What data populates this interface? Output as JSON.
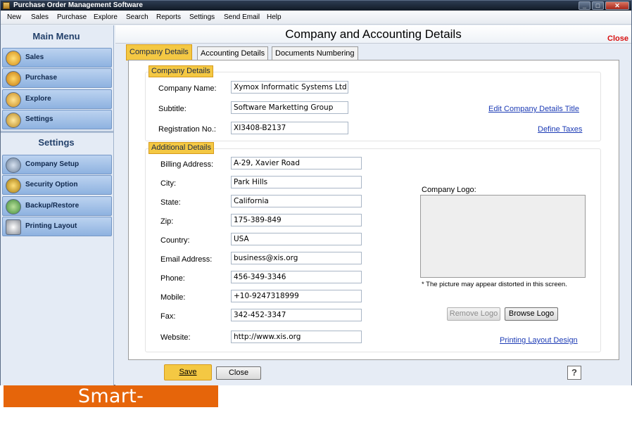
{
  "window": {
    "title": "Purchase Order Management Software"
  },
  "menu": [
    "New",
    "Sales",
    "Purchase",
    "Explore",
    "Search",
    "Reports",
    "Settings",
    "Send Email",
    "Help"
  ],
  "sidebar": {
    "main_menu_title": "Main Menu",
    "main_items": [
      {
        "label": "Sales",
        "icon": "sales-chart-icon"
      },
      {
        "label": "Purchase",
        "icon": "purchase-cart-icon"
      },
      {
        "label": "Explore",
        "icon": "explore-icon"
      },
      {
        "label": "Settings",
        "icon": "settings-icon"
      }
    ],
    "settings_title": "Settings",
    "settings_items": [
      {
        "label": "Company Setup",
        "icon": "company-setup-icon"
      },
      {
        "label": "Security Option",
        "icon": "lock-icon"
      },
      {
        "label": "Backup/Restore",
        "icon": "backup-restore-icon"
      },
      {
        "label": "Printing Layout",
        "icon": "printer-icon"
      }
    ]
  },
  "panel": {
    "title": "Company and Accounting Details",
    "close_label": "Close",
    "tabs": [
      "Company Details",
      "Accounting Details",
      "Documents Numbering"
    ],
    "active_tab": "Company Details"
  },
  "company_details": {
    "group_label": "Company Details",
    "fields": [
      {
        "label": "Company Name:",
        "value": "Xymox Informatic Systems Ltd"
      },
      {
        "label": "Subtitle:",
        "value": "Software Marketting Group"
      },
      {
        "label": "Registration No.:",
        "value": "XI3408-B2137"
      }
    ],
    "edit_title_link": "Edit Company Details Title",
    "define_taxes_link": "Define Taxes"
  },
  "additional_details": {
    "group_label": "Additional Details",
    "fields": [
      {
        "label": "Billing Address:",
        "value": "A-29, Xavier Road"
      },
      {
        "label": "City:",
        "value": "Park Hills"
      },
      {
        "label": "State:",
        "value": "California"
      },
      {
        "label": "Zip:",
        "value": "175-389-849"
      },
      {
        "label": "Country:",
        "value": "USA"
      },
      {
        "label": "Email Address:",
        "value": "business@xis.org"
      },
      {
        "label": "Phone:",
        "value": "456-349-3346"
      },
      {
        "label": "Mobile:",
        "value": "+10-9247318999"
      },
      {
        "label": "Fax:",
        "value": "342-452-3347"
      },
      {
        "label": "Website:",
        "value": "http://www.xis.org"
      }
    ],
    "logo_label": "Company Logo:",
    "logo_note": "* The picture may appear distorted in this screen.",
    "remove_logo_label": "Remove Logo",
    "browse_logo_label": "Browse Logo",
    "printing_layout_link": "Printing Layout Design"
  },
  "footer": {
    "save_label": "Save",
    "close_label": "Close",
    "help_glyph": "?"
  },
  "watermark": "Smart-Accountant.com",
  "colors": {
    "accent": "#f4c843",
    "close_red": "#d81010",
    "link_blue": "#1c3bb5",
    "watermark": "#e6650a",
    "sidebar_item": "#a6c4ea"
  }
}
